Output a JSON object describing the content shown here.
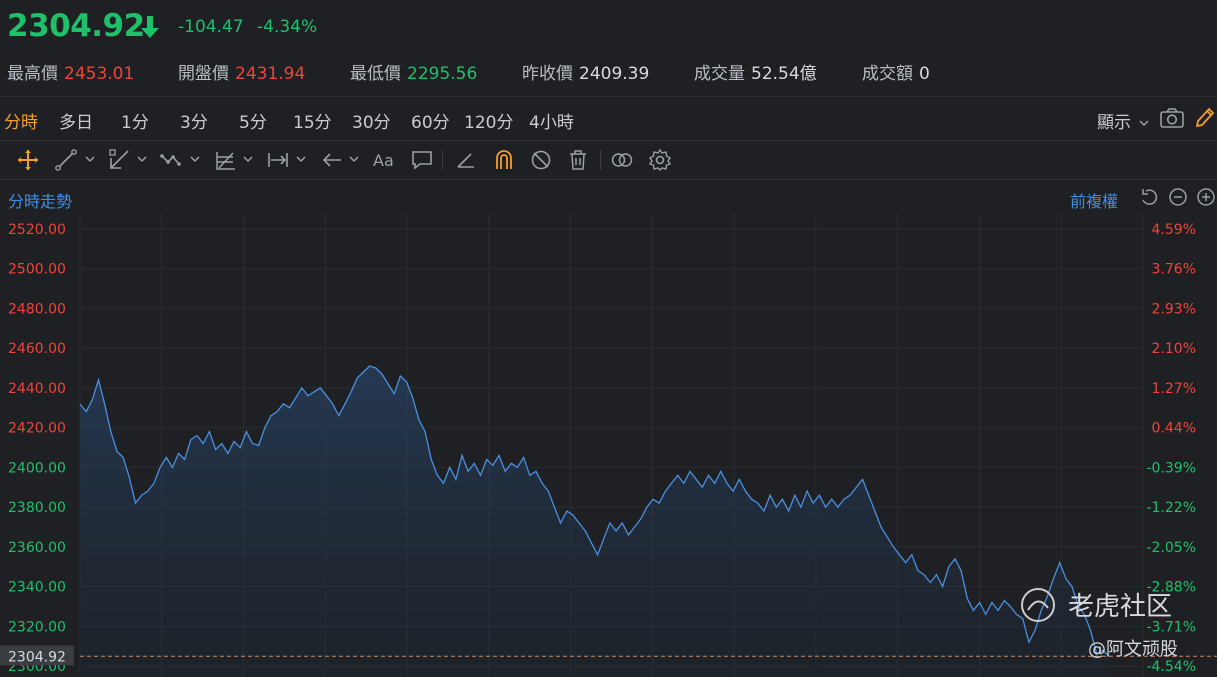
{
  "quote": {
    "price": "2304.92",
    "change": "-104.47",
    "change_pct": "-4.34%",
    "stats": [
      {
        "label": "最高價",
        "value": "2453.01",
        "tone": "red"
      },
      {
        "label": "開盤價",
        "value": "2431.94",
        "tone": "red"
      },
      {
        "label": "最低價",
        "value": "2295.56",
        "tone": "green"
      },
      {
        "label": "昨收價",
        "value": "2409.39",
        "tone": "white"
      },
      {
        "label": "成交量",
        "value": "52.54億",
        "tone": "white"
      },
      {
        "label": "成交額",
        "value": "0",
        "tone": "white"
      }
    ]
  },
  "periods": [
    "分時",
    "多日",
    "1分",
    "3分",
    "5分",
    "15分",
    "30分",
    "60分",
    "120分",
    "4小時"
  ],
  "active_period": "分時",
  "display_label": "顯示",
  "icons": [
    "move-icon",
    "line-tool-icon",
    "channel-tool-icon",
    "wave-tool-icon",
    "fib-tool-icon",
    "measure-tool-icon",
    "arrow-tool-icon",
    "text-tool-icon",
    "comment-tool-icon",
    "pencil-tool-icon",
    "magnet-icon",
    "hide-icon",
    "trash-icon",
    "compare-icon",
    "settings-icon",
    "camera-icon",
    "edit-icon",
    "undo-icon",
    "zoom-out-icon",
    "zoom-in-icon"
  ],
  "chart_title": "分時走勢",
  "adjust_label": "前複權",
  "watermark": {
    "brand": "老虎社区",
    "author": "@阿文顽股"
  },
  "colors": {
    "up": "#f0443a",
    "down": "#1fc06a",
    "line": "#4a8fe0",
    "accent": "#f59e2b",
    "blue": "#3f8fe8"
  },
  "chart_data": {
    "type": "area",
    "prev_close": 2409.39,
    "last_price": 2304.92,
    "last_label": "2304.92",
    "ylim": [
      2294.5,
      2527.5
    ],
    "y_ticks": [
      "2520.00",
      "2500.00",
      "2480.00",
      "2460.00",
      "2440.00",
      "2420.00",
      "2400.00",
      "2380.00",
      "2360.00",
      "2340.00",
      "2320.00",
      "2300.00"
    ],
    "pct_ticks": [
      "4.59%",
      "3.76%",
      "2.93%",
      "2.10%",
      "1.27%",
      "0.44%",
      "-0.39%",
      "-1.22%",
      "-2.05%",
      "-2.88%",
      "-3.71%",
      "-4.54%"
    ],
    "grid": true,
    "series": [
      {
        "x": 0,
        "y": 2431.9
      },
      {
        "x": 3,
        "y": 2428
      },
      {
        "x": 6,
        "y": 2434
      },
      {
        "x": 9,
        "y": 2444
      },
      {
        "x": 12,
        "y": 2432
      },
      {
        "x": 15,
        "y": 2418
      },
      {
        "x": 18,
        "y": 2408
      },
      {
        "x": 21,
        "y": 2405
      },
      {
        "x": 24,
        "y": 2395
      },
      {
        "x": 27,
        "y": 2382
      },
      {
        "x": 30,
        "y": 2386
      },
      {
        "x": 33,
        "y": 2388
      },
      {
        "x": 36,
        "y": 2392
      },
      {
        "x": 39,
        "y": 2400
      },
      {
        "x": 42,
        "y": 2405
      },
      {
        "x": 45,
        "y": 2400
      },
      {
        "x": 48,
        "y": 2407
      },
      {
        "x": 51,
        "y": 2404
      },
      {
        "x": 54,
        "y": 2414
      },
      {
        "x": 57,
        "y": 2416
      },
      {
        "x": 60,
        "y": 2412
      },
      {
        "x": 63,
        "y": 2418
      },
      {
        "x": 66,
        "y": 2409
      },
      {
        "x": 69,
        "y": 2412
      },
      {
        "x": 72,
        "y": 2407
      },
      {
        "x": 75,
        "y": 2413
      },
      {
        "x": 78,
        "y": 2410
      },
      {
        "x": 81,
        "y": 2418
      },
      {
        "x": 84,
        "y": 2412
      },
      {
        "x": 87,
        "y": 2411
      },
      {
        "x": 90,
        "y": 2420
      },
      {
        "x": 93,
        "y": 2426
      },
      {
        "x": 96,
        "y": 2428
      },
      {
        "x": 99,
        "y": 2432
      },
      {
        "x": 102,
        "y": 2430
      },
      {
        "x": 105,
        "y": 2435
      },
      {
        "x": 108,
        "y": 2440
      },
      {
        "x": 111,
        "y": 2436
      },
      {
        "x": 114,
        "y": 2438
      },
      {
        "x": 117,
        "y": 2440
      },
      {
        "x": 120,
        "y": 2436
      },
      {
        "x": 123,
        "y": 2432
      },
      {
        "x": 126,
        "y": 2426
      },
      {
        "x": 129,
        "y": 2432
      },
      {
        "x": 132,
        "y": 2438
      },
      {
        "x": 135,
        "y": 2445
      },
      {
        "x": 138,
        "y": 2448
      },
      {
        "x": 141,
        "y": 2451
      },
      {
        "x": 144,
        "y": 2450
      },
      {
        "x": 147,
        "y": 2447
      },
      {
        "x": 150,
        "y": 2442
      },
      {
        "x": 153,
        "y": 2437
      },
      {
        "x": 156,
        "y": 2446
      },
      {
        "x": 159,
        "y": 2443
      },
      {
        "x": 162,
        "y": 2435
      },
      {
        "x": 165,
        "y": 2424
      },
      {
        "x": 168,
        "y": 2418
      },
      {
        "x": 171,
        "y": 2404
      },
      {
        "x": 174,
        "y": 2396
      },
      {
        "x": 177,
        "y": 2392
      },
      {
        "x": 180,
        "y": 2400
      },
      {
        "x": 183,
        "y": 2394
      },
      {
        "x": 186,
        "y": 2406
      },
      {
        "x": 189,
        "y": 2398
      },
      {
        "x": 192,
        "y": 2402
      },
      {
        "x": 195,
        "y": 2396
      },
      {
        "x": 198,
        "y": 2404
      },
      {
        "x": 201,
        "y": 2401
      },
      {
        "x": 204,
        "y": 2406
      },
      {
        "x": 207,
        "y": 2398
      },
      {
        "x": 210,
        "y": 2402
      },
      {
        "x": 213,
        "y": 2400
      },
      {
        "x": 216,
        "y": 2405
      },
      {
        "x": 219,
        "y": 2396
      },
      {
        "x": 222,
        "y": 2398
      },
      {
        "x": 225,
        "y": 2392
      },
      {
        "x": 228,
        "y": 2388
      },
      {
        "x": 231,
        "y": 2380
      },
      {
        "x": 234,
        "y": 2372
      },
      {
        "x": 237,
        "y": 2378
      },
      {
        "x": 240,
        "y": 2376
      },
      {
        "x": 243,
        "y": 2372
      },
      {
        "x": 246,
        "y": 2368
      },
      {
        "x": 249,
        "y": 2362
      },
      {
        "x": 252,
        "y": 2356
      },
      {
        "x": 255,
        "y": 2364
      },
      {
        "x": 258,
        "y": 2372
      },
      {
        "x": 261,
        "y": 2368
      },
      {
        "x": 264,
        "y": 2372
      },
      {
        "x": 267,
        "y": 2366
      },
      {
        "x": 270,
        "y": 2370
      },
      {
        "x": 273,
        "y": 2374
      },
      {
        "x": 276,
        "y": 2380
      },
      {
        "x": 279,
        "y": 2384
      },
      {
        "x": 282,
        "y": 2382
      },
      {
        "x": 285,
        "y": 2388
      },
      {
        "x": 288,
        "y": 2392
      },
      {
        "x": 291,
        "y": 2396
      },
      {
        "x": 294,
        "y": 2392
      },
      {
        "x": 297,
        "y": 2398
      },
      {
        "x": 300,
        "y": 2394
      },
      {
        "x": 303,
        "y": 2390
      },
      {
        "x": 306,
        "y": 2396
      },
      {
        "x": 309,
        "y": 2392
      },
      {
        "x": 312,
        "y": 2398
      },
      {
        "x": 315,
        "y": 2392
      },
      {
        "x": 318,
        "y": 2388
      },
      {
        "x": 321,
        "y": 2394
      },
      {
        "x": 324,
        "y": 2388
      },
      {
        "x": 327,
        "y": 2384
      },
      {
        "x": 330,
        "y": 2382
      },
      {
        "x": 333,
        "y": 2378
      },
      {
        "x": 336,
        "y": 2386
      },
      {
        "x": 339,
        "y": 2380
      },
      {
        "x": 342,
        "y": 2384
      },
      {
        "x": 345,
        "y": 2378
      },
      {
        "x": 348,
        "y": 2386
      },
      {
        "x": 351,
        "y": 2380
      },
      {
        "x": 354,
        "y": 2388
      },
      {
        "x": 357,
        "y": 2382
      },
      {
        "x": 360,
        "y": 2386
      },
      {
        "x": 363,
        "y": 2380
      },
      {
        "x": 366,
        "y": 2384
      },
      {
        "x": 369,
        "y": 2380
      },
      {
        "x": 372,
        "y": 2384
      },
      {
        "x": 375,
        "y": 2386
      },
      {
        "x": 378,
        "y": 2390
      },
      {
        "x": 381,
        "y": 2394
      },
      {
        "x": 384,
        "y": 2386
      },
      {
        "x": 387,
        "y": 2378
      },
      {
        "x": 390,
        "y": 2370
      },
      {
        "x": 393,
        "y": 2365
      },
      {
        "x": 396,
        "y": 2360
      },
      {
        "x": 399,
        "y": 2356
      },
      {
        "x": 402,
        "y": 2352
      },
      {
        "x": 405,
        "y": 2356
      },
      {
        "x": 408,
        "y": 2348
      },
      {
        "x": 411,
        "y": 2346
      },
      {
        "x": 414,
        "y": 2342
      },
      {
        "x": 417,
        "y": 2346
      },
      {
        "x": 420,
        "y": 2340
      },
      {
        "x": 423,
        "y": 2350
      },
      {
        "x": 426,
        "y": 2354
      },
      {
        "x": 429,
        "y": 2348
      },
      {
        "x": 432,
        "y": 2334
      },
      {
        "x": 435,
        "y": 2328
      },
      {
        "x": 438,
        "y": 2332
      },
      {
        "x": 441,
        "y": 2326
      },
      {
        "x": 444,
        "y": 2332
      },
      {
        "x": 447,
        "y": 2328
      },
      {
        "x": 450,
        "y": 2333
      },
      {
        "x": 453,
        "y": 2330
      },
      {
        "x": 456,
        "y": 2326
      },
      {
        "x": 459,
        "y": 2324
      },
      {
        "x": 462,
        "y": 2312
      },
      {
        "x": 465,
        "y": 2318
      },
      {
        "x": 468,
        "y": 2328
      },
      {
        "x": 471,
        "y": 2335
      },
      {
        "x": 474,
        "y": 2344
      },
      {
        "x": 477,
        "y": 2352
      },
      {
        "x": 480,
        "y": 2344
      },
      {
        "x": 483,
        "y": 2340
      },
      {
        "x": 486,
        "y": 2330
      },
      {
        "x": 489,
        "y": 2326
      },
      {
        "x": 492,
        "y": 2318
      },
      {
        "x": 495,
        "y": 2306
      },
      {
        "x": 498,
        "y": 2308
      },
      {
        "x": 501,
        "y": 2304.9
      }
    ]
  }
}
